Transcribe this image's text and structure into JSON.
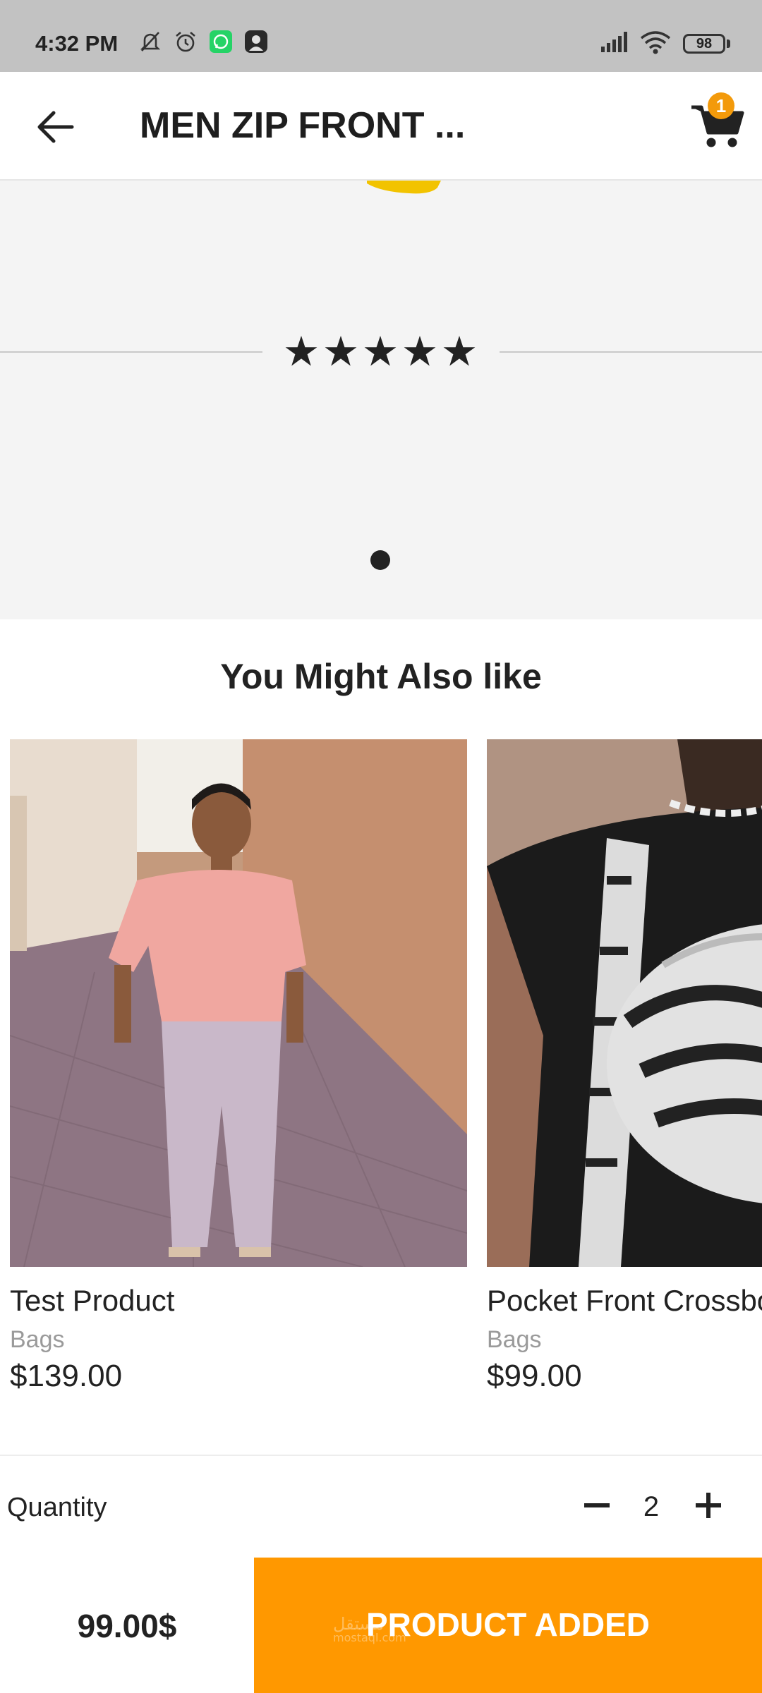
{
  "status_bar": {
    "time": "4:32 PM",
    "battery": "98",
    "icons": [
      "muted-bell-icon",
      "alarm-icon",
      "whatsapp-icon",
      "avatar-icon",
      "signal-icon",
      "wifi-icon",
      "battery-icon"
    ]
  },
  "app_bar": {
    "title": "MEN ZIP FRONT ...",
    "cart_count": "1",
    "icons": [
      "back-arrow-icon",
      "cart-icon"
    ]
  },
  "product": {
    "rating_stars": 5,
    "gallery_pages": 1,
    "gallery_active_page": 1
  },
  "recommendations": {
    "title": "You Might Also like",
    "items": [
      {
        "name": "Test Product",
        "category": "Bags",
        "price": "$139.00"
      },
      {
        "name": "Pocket Front Crossbody",
        "category": "Bags",
        "price": "$99.00"
      }
    ]
  },
  "quantity": {
    "label": "Quantity",
    "value": "2"
  },
  "footer": {
    "total": "99.00$",
    "button_label": "PRODUCT ADDED",
    "watermark": "مستقل",
    "watermark_domain": "mostaql.com"
  },
  "colors": {
    "accent": "#ff9800",
    "badge": "#f39a0b",
    "status_bar": "#c2c2c2",
    "gallery_bg": "#f4f4f4"
  }
}
